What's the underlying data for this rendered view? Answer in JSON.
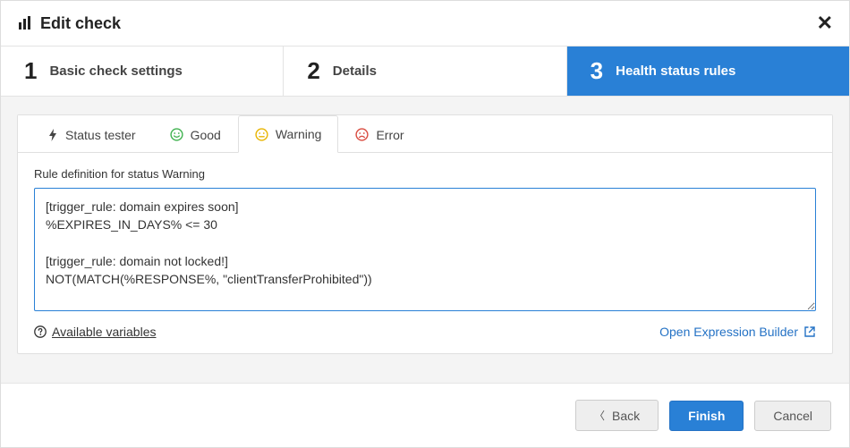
{
  "header": {
    "title": "Edit check"
  },
  "steps": [
    {
      "num": "1",
      "label": "Basic check settings"
    },
    {
      "num": "2",
      "label": "Details"
    },
    {
      "num": "3",
      "label": "Health status rules"
    }
  ],
  "active_step_index": 2,
  "tabs": {
    "status_tester": "Status tester",
    "good": "Good",
    "warning": "Warning",
    "error": "Error",
    "active": "warning"
  },
  "rule": {
    "label": "Rule definition for status Warning",
    "value": "[trigger_rule: domain expires soon]\n%EXPIRES_IN_DAYS% <= 30\n\n[trigger_rule: domain not locked!]\nNOT(MATCH(%RESPONSE%, \"clientTransferProhibited\"))"
  },
  "links": {
    "available_variables": "Available variables",
    "open_expression_builder": "Open Expression Builder"
  },
  "footer": {
    "back": "Back",
    "finish": "Finish",
    "cancel": "Cancel"
  },
  "colors": {
    "primary": "#2980d6",
    "good": "#3fb24f",
    "warning": "#e8b400",
    "error": "#d94b3f"
  }
}
